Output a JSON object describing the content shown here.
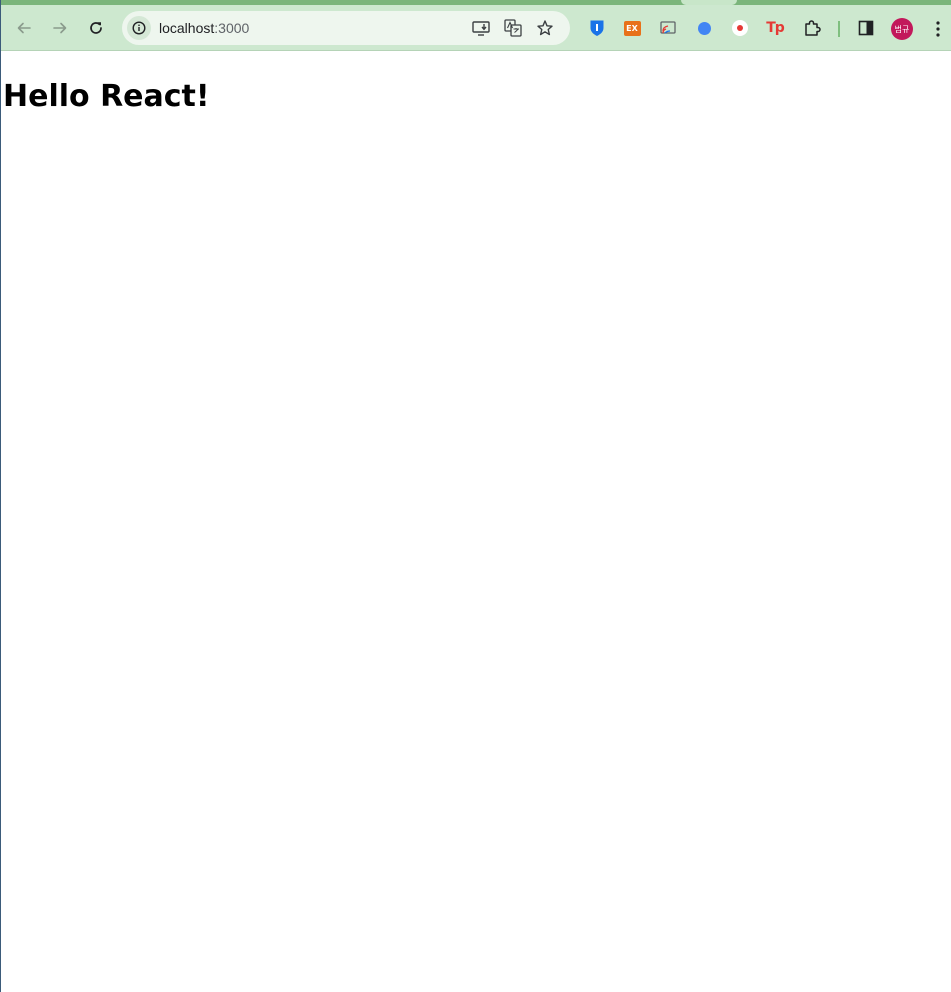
{
  "browser": {
    "address_bar": {
      "host": "localhost",
      "port": ":3000"
    },
    "icons": {
      "back": "arrow-left-icon",
      "forward": "arrow-right-icon",
      "reload": "reload-icon",
      "site_info": "info-icon",
      "install": "install-app-icon",
      "translate": "translate-icon",
      "bookmark": "star-icon",
      "extensions": "puzzle-icon",
      "side_panel": "side-panel-icon",
      "menu": "kebab-menu-icon"
    },
    "extensions": [
      {
        "name": "bitwarden",
        "label": "",
        "color": "#1a73e8"
      },
      {
        "name": "ex",
        "label": "EX",
        "color": "#e8711a"
      },
      {
        "name": "cast",
        "label": "",
        "color": "#5f6368"
      },
      {
        "name": "blue-dot",
        "label": "",
        "color": "#4285f4"
      },
      {
        "name": "red-dot",
        "label": "",
        "color": "#e53935"
      },
      {
        "name": "tp",
        "label": "Tp",
        "color": "#e53935"
      }
    ],
    "profile": {
      "avatar_text": "범규",
      "color": "#c2185b"
    },
    "colors": {
      "toolbar": "#cde8cf",
      "tabstrip": "#7bb57b",
      "omnibox": "#eef6ee"
    }
  },
  "page": {
    "heading": "Hello React!"
  }
}
